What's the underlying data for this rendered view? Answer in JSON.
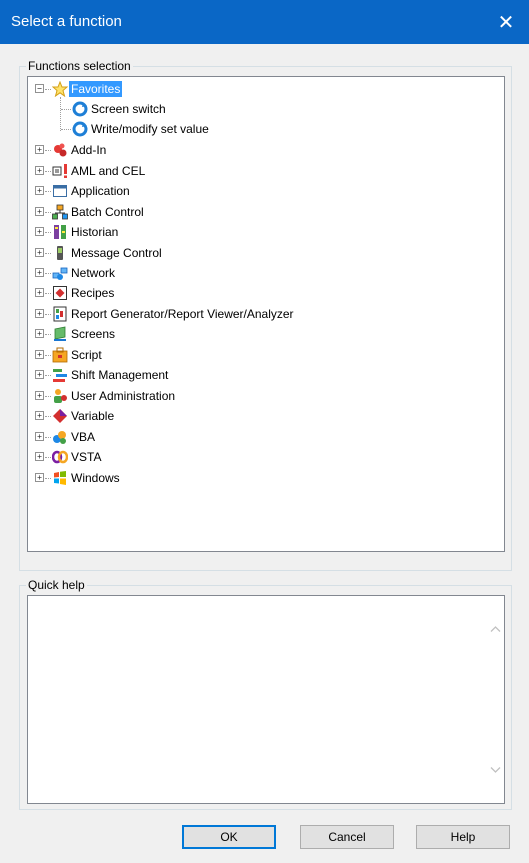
{
  "window": {
    "title": "Select a function",
    "close_glyph": "✕"
  },
  "functions_selection": {
    "legend": "Functions selection",
    "tree": [
      {
        "label": "Favorites",
        "icon": "star-icon",
        "expander": "−",
        "selected": true,
        "children": [
          {
            "label": "Screen switch",
            "icon": "function-icon"
          },
          {
            "label": "Write/modify set value",
            "icon": "function-icon"
          }
        ]
      },
      {
        "label": "Add-In",
        "icon": "addin-icon",
        "expander": "+"
      },
      {
        "label": "AML and CEL",
        "icon": "aml-cel-icon",
        "expander": "+"
      },
      {
        "label": "Application",
        "icon": "application-icon",
        "expander": "+"
      },
      {
        "label": "Batch Control",
        "icon": "batch-control-icon",
        "expander": "+"
      },
      {
        "label": "Historian",
        "icon": "historian-icon",
        "expander": "+"
      },
      {
        "label": "Message Control",
        "icon": "message-control-icon",
        "expander": "+"
      },
      {
        "label": "Network",
        "icon": "network-icon",
        "expander": "+"
      },
      {
        "label": "Recipes",
        "icon": "recipes-icon",
        "expander": "+"
      },
      {
        "label": "Report Generator/Report Viewer/Analyzer",
        "icon": "report-icon",
        "expander": "+"
      },
      {
        "label": "Screens",
        "icon": "screens-icon",
        "expander": "+"
      },
      {
        "label": "Script",
        "icon": "script-icon",
        "expander": "+"
      },
      {
        "label": "Shift Management",
        "icon": "shift-management-icon",
        "expander": "+"
      },
      {
        "label": "User Administration",
        "icon": "user-admin-icon",
        "expander": "+"
      },
      {
        "label": "Variable",
        "icon": "variable-icon",
        "expander": "+"
      },
      {
        "label": "VBA",
        "icon": "vba-icon",
        "expander": "+"
      },
      {
        "label": "VSTA",
        "icon": "vsta-icon",
        "expander": "+"
      },
      {
        "label": "Windows",
        "icon": "windows-icon",
        "expander": "+"
      }
    ]
  },
  "quick_help": {
    "legend": "Quick help",
    "text": ""
  },
  "buttons": {
    "ok": "OK",
    "cancel": "Cancel",
    "help": "Help"
  },
  "colors": {
    "titlebar": "#0a67c6",
    "selection": "#3399ff",
    "default_button_border": "#0078d7"
  }
}
